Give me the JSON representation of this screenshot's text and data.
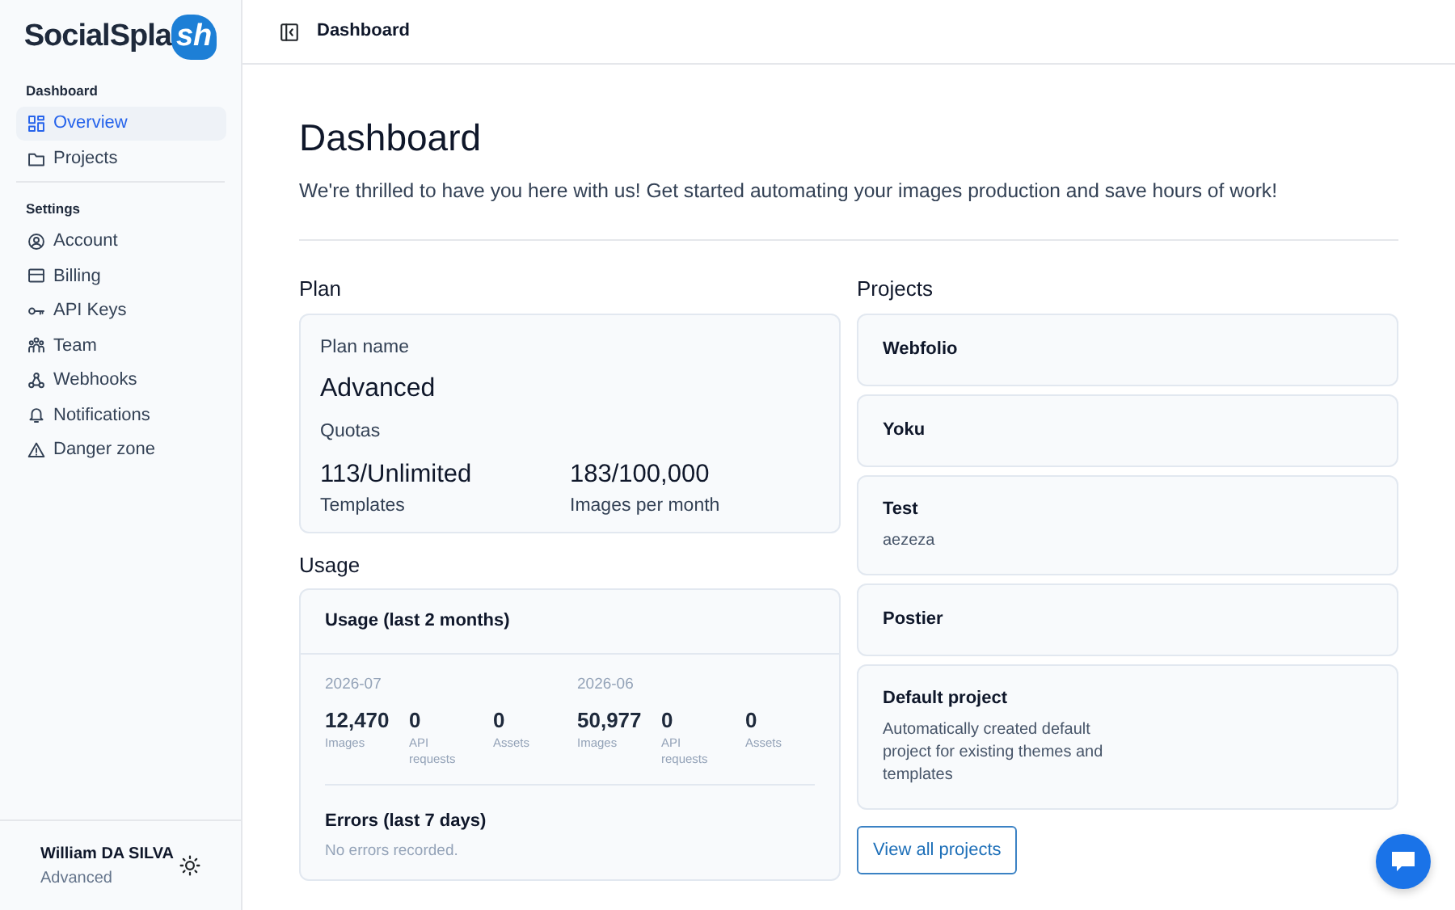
{
  "logo": {
    "text": "SocialSpla",
    "accent": "sh"
  },
  "sidebar": {
    "sections": [
      {
        "heading": "Dashboard",
        "items": [
          {
            "label": "Overview",
            "selected": true
          },
          {
            "label": "Projects",
            "selected": false
          }
        ]
      },
      {
        "heading": "Settings",
        "items": [
          {
            "label": "Account",
            "selected": false
          },
          {
            "label": "Billing",
            "selected": false
          },
          {
            "label": "API Keys",
            "selected": false
          },
          {
            "label": "Team",
            "selected": false
          },
          {
            "label": "Webhooks",
            "selected": false
          },
          {
            "label": "Notifications",
            "selected": false
          },
          {
            "label": "Danger zone",
            "selected": false
          }
        ]
      }
    ],
    "user": {
      "name": "William DA SILVA",
      "plan": "Advanced"
    }
  },
  "header": {
    "title": "Dashboard"
  },
  "page": {
    "title": "Dashboard",
    "intro": "We're thrilled to have you here with us! Get started automating your images production and save hours of work!"
  },
  "plan": {
    "heading": "Plan",
    "name_label": "Plan name",
    "name": "Advanced",
    "quotas_label": "Quotas",
    "quotas": [
      {
        "value": "113/Unlimited",
        "label": "Templates"
      },
      {
        "value": "183/100,000",
        "label": "Images per month"
      }
    ]
  },
  "usage": {
    "heading": "Usage",
    "card_title": "Usage (last 2 months)",
    "months": [
      {
        "month": "2026-07",
        "stats": [
          {
            "value": "12,470",
            "label": "Images"
          },
          {
            "value": "0",
            "label": "API requests"
          },
          {
            "value": "0",
            "label": "Assets"
          }
        ]
      },
      {
        "month": "2026-06",
        "stats": [
          {
            "value": "50,977",
            "label": "Images"
          },
          {
            "value": "0",
            "label": "API requests"
          },
          {
            "value": "0",
            "label": "Assets"
          }
        ]
      }
    ],
    "errors_title": "Errors (last 7 days)",
    "errors_text": "No errors recorded."
  },
  "projects": {
    "heading": "Projects",
    "items": [
      {
        "name": "Webfolio"
      },
      {
        "name": "Yoku"
      },
      {
        "name": "Test",
        "description": "aezeza"
      },
      {
        "name": "Postier"
      },
      {
        "name": "Default project",
        "description": "Automatically created default project for existing themes and templates"
      }
    ],
    "button": "View all projects"
  }
}
